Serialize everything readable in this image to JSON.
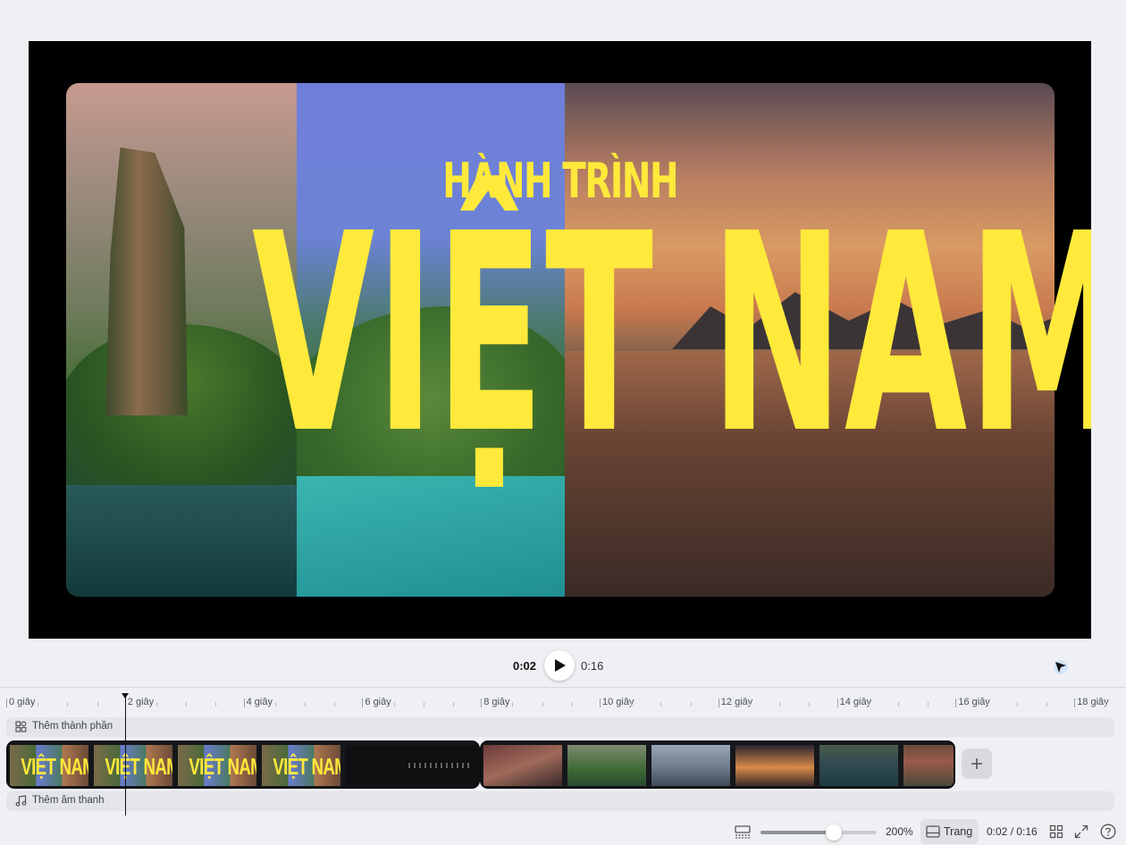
{
  "preview": {
    "title_small": "HÀNH TRÌNH",
    "title_big": "VIỆT NAM"
  },
  "player": {
    "current_time": "0:02",
    "total_time": "0:16"
  },
  "ruler": {
    "labels": [
      "0 giây",
      "2 giây",
      "4 giây",
      "6 giây",
      "8 giây",
      "10 giây",
      "12 giây",
      "14 giây",
      "16 giây",
      "18 giây"
    ]
  },
  "tracks": {
    "add_element_label": "Thêm thành phần",
    "add_audio_label": "Thêm âm thanh",
    "thumb_text": "VIỆT NAM"
  },
  "bottom_bar": {
    "zoom_label": "200%",
    "zoom_level_fraction": 0.63,
    "page_label": "Trang",
    "time_display": "0:02 / 0:16"
  },
  "colors": {
    "title_yellow": "#ffe93b",
    "background": "#eff0f4"
  }
}
